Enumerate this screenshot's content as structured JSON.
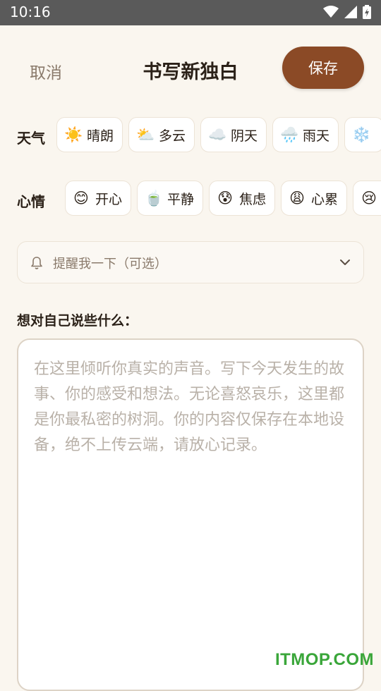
{
  "status": {
    "time": "10:16"
  },
  "header": {
    "cancel_label": "取消",
    "title": "书写新独白",
    "save_label": "保存"
  },
  "weather": {
    "label": "天气",
    "options": [
      {
        "emoji": "☀️",
        "label": "晴朗"
      },
      {
        "emoji": "⛅",
        "label": "多云"
      },
      {
        "emoji": "☁️",
        "label": "阴天"
      },
      {
        "emoji": "🌧️",
        "label": "雨天"
      },
      {
        "emoji": "❄️",
        "label": ""
      }
    ]
  },
  "mood": {
    "label": "心情",
    "options": [
      {
        "emoji": "😊",
        "label": "开心"
      },
      {
        "emoji": "🍵",
        "label": "平静"
      },
      {
        "emoji": "😰",
        "label": "焦虑"
      },
      {
        "emoji": "😩",
        "label": "心累"
      },
      {
        "emoji": "😢",
        "label": ""
      }
    ]
  },
  "reminder": {
    "placeholder": "提醒我一下（可选）"
  },
  "editor": {
    "label": "想对自己说些什么：",
    "placeholder": "在这里倾听你真实的声音。写下今天发生的故事、你的感受和想法。无论喜怒哀乐，这里都是你最私密的树洞。你的内容仅保存在本地设备，绝不上传云端，请放心记录。"
  },
  "watermark": "ITMOP.COM",
  "colors": {
    "accent": "#8b4a26",
    "background": "#faf6ef"
  }
}
